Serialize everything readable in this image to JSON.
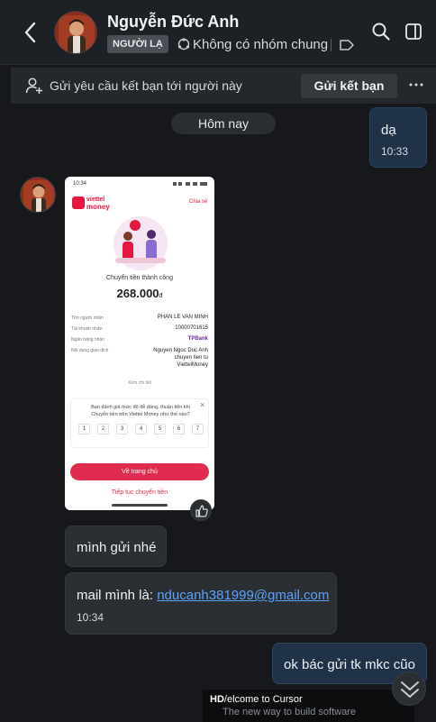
{
  "header": {
    "contact_name": "Nguyễn Đức Anh",
    "badge": "NGƯỜI LẠ",
    "common_groups": "Không có nhóm chung"
  },
  "request_bar": {
    "text": "Gửi yêu cầu kết bạn tới người này",
    "button": "Gửi kết bạn"
  },
  "date_separator": "Hôm nay",
  "messages": [
    {
      "from": "me",
      "text": "dạ",
      "time": "10:33"
    },
    {
      "from": "them",
      "text": "mình gửi nhé"
    },
    {
      "from": "them",
      "text_prefix": "mail mình là: ",
      "email": "nducanh381999@gmail.com",
      "time": "10:34"
    },
    {
      "from": "me",
      "text": "ok bác gửi tk mkc cũo"
    }
  ],
  "screenshot": {
    "status_time": "10:34",
    "brand_line1": "viettel",
    "brand_line2": "money",
    "share": "Chia sẻ",
    "status": "Chuyển tiền thành công",
    "amount": "268.000",
    "currency": "đ",
    "rows": [
      {
        "label": "Tên người nhận",
        "value": "PHAN LE VAN MINH"
      },
      {
        "label": "Tài khoản nhận",
        "value": "10000701615"
      },
      {
        "label": "Ngân hàng nhận",
        "value": "TPBank"
      },
      {
        "label": "Nội dung giao dịch",
        "value": "Nguyen Ngoc Duc Anh chuyen tien tu ViettelMoney"
      }
    ],
    "more": "Xem chi tiết",
    "survey_question": "Bạn đánh giá mức độ dễ dàng, thuận tiện khi Chuyển tiền trên Viettel Money như thế nào?",
    "survey_scale": [
      "1",
      "2",
      "3",
      "4",
      "5",
      "6",
      "7"
    ],
    "primary_button": "Về trang chủ",
    "secondary_link": "Tiếp tục chuyển tiền"
  },
  "toast": {
    "prefix": "HD",
    "title": "/elcome to Cursor",
    "subtitle": "The new way to build software"
  }
}
